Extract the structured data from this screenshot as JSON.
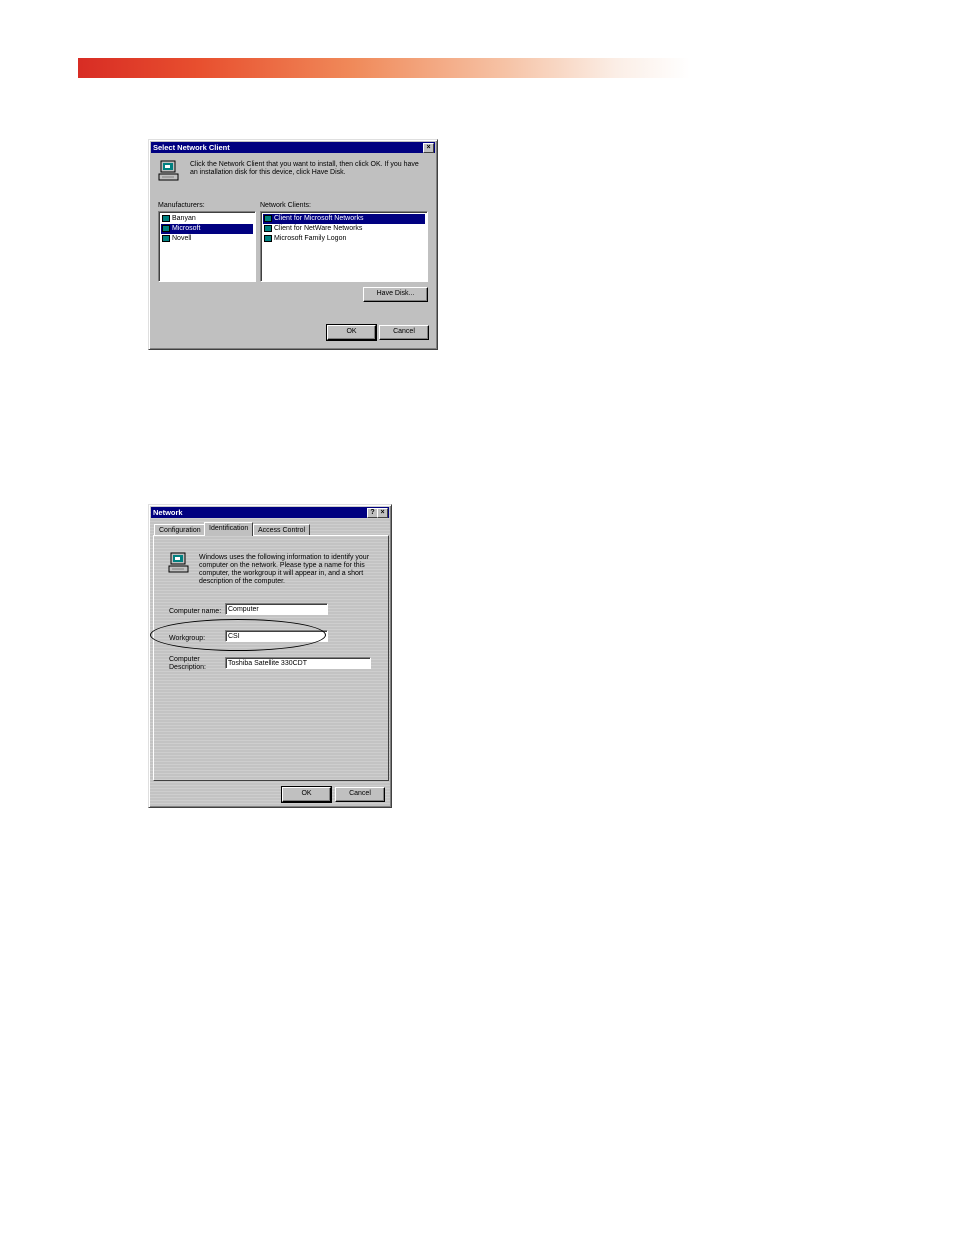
{
  "dialog1": {
    "title": "Select Network Client",
    "close_glyph": "×",
    "instructions_line1": "Click the Network Client that you want to install, then click OK. If you have",
    "instructions_line2": "an installation disk for this device, click Have Disk.",
    "manufacturers_label": "Manufacturers:",
    "manufacturers": [
      "Banyan",
      "Microsoft",
      "Novell"
    ],
    "selected_manufacturer": "Microsoft",
    "clients_label": "Network Clients:",
    "clients": [
      "Client for Microsoft Networks",
      "Client for NetWare Networks",
      "Microsoft Family Logon"
    ],
    "selected_client": "Client for Microsoft Networks",
    "have_disk_label": "Have Disk...",
    "ok_label": "OK",
    "cancel_label": "Cancel",
    "icon": "network-computer-icon"
  },
  "dialog2": {
    "title": "Network",
    "help_glyph": "?",
    "close_glyph": "×",
    "tabs": [
      "Configuration",
      "Identification",
      "Access Control"
    ],
    "active_tab": "Identification",
    "info_line1": "Windows uses the following information to identify your",
    "info_line2": "computer on the network.  Please type a name for this",
    "info_line3": "computer, the workgroup it will appear in, and a short",
    "info_line4": "description of the computer.",
    "computer_name_label": "Computer name:",
    "computer_name_value": "Computer",
    "workgroup_label": "Workgroup:",
    "workgroup_value": "CSI",
    "description_label_line1": "Computer",
    "description_label_line2": "Description:",
    "description_value": "Toshiba Satellite 330CDT",
    "ok_label": "OK",
    "cancel_label": "Cancel",
    "icon": "network-computer-icon"
  },
  "colors": {
    "titlebar": "#000080",
    "dialog_face": "#c0c0c0",
    "band_start": "#d82c24"
  }
}
